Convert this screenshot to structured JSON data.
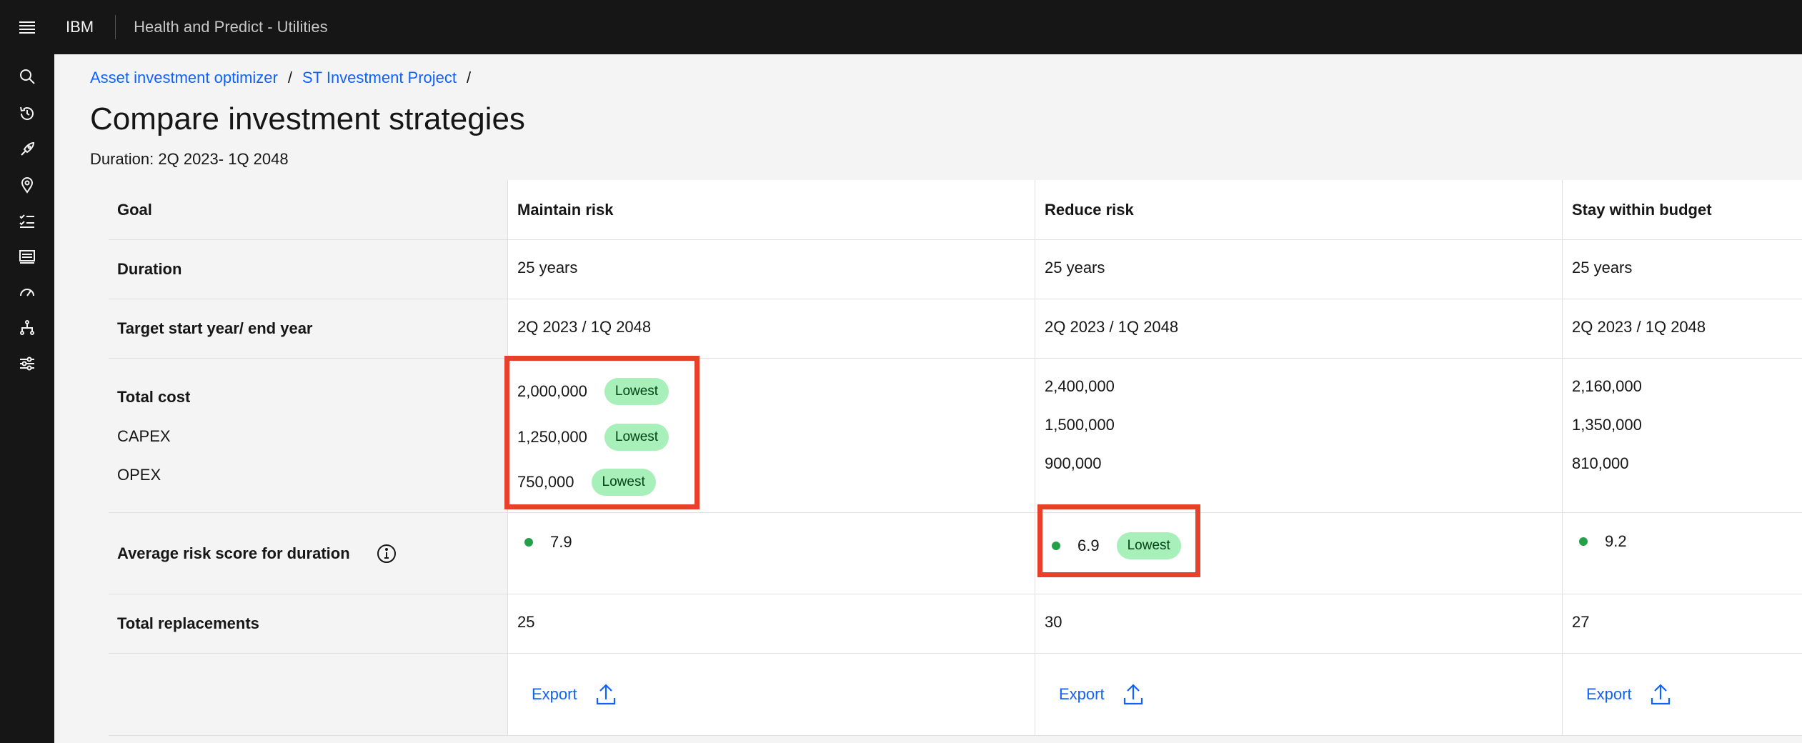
{
  "header": {
    "brand": "IBM",
    "app_name": "Health and Predict - Utilities"
  },
  "sidebar": {
    "icons": [
      "search-icon",
      "recent-history-icon",
      "rocket-icon",
      "location-pin-icon",
      "checklist-icon",
      "dashboard-card-icon",
      "gauge-icon",
      "hierarchy-icon",
      "settings-adjust-icon"
    ]
  },
  "breadcrumb": {
    "item1": "Asset investment optimizer",
    "item2": "ST Investment Project",
    "separator": "/"
  },
  "page": {
    "title": "Compare investment strategies",
    "duration": "Duration: 2Q 2023- 1Q 2048"
  },
  "row_labels": {
    "goal": "Goal",
    "duration": "Duration",
    "target": "Target start year/ end year",
    "total_cost": "Total cost",
    "capex": "CAPEX",
    "opex": "OPEX",
    "risk": "Average risk score for duration",
    "replacements": "Total replacements"
  },
  "tag_label": "Lowest",
  "strategies": [
    {
      "goal": "Maintain risk",
      "duration": "25 years",
      "target": "2Q 2023 / 1Q 2048",
      "total_cost": "2,000,000",
      "capex": "1,250,000",
      "opex": "750,000",
      "risk": "7.9",
      "replacements": "25",
      "export": "Export"
    },
    {
      "goal": "Reduce risk",
      "duration": "25 years",
      "target": "2Q 2023 / 1Q 2048",
      "total_cost": "2,400,000",
      "capex": "1,500,000",
      "opex": "900,000",
      "risk": "6.9",
      "replacements": "30",
      "export": "Export"
    },
    {
      "goal": "Stay within budget",
      "duration": "25 years",
      "target": "2Q 2023 / 1Q 2048",
      "total_cost": "2,160,000",
      "capex": "1,350,000",
      "opex": "810,000",
      "risk": "9.2",
      "replacements": "27",
      "export": "Export"
    }
  ],
  "colors": {
    "header_bg": "#161616",
    "link": "#0f62fe",
    "tag_bg": "#a7f0ba",
    "tag_text": "#044317",
    "status_dot": "#24a148",
    "highlight_box": "#e9402b"
  }
}
